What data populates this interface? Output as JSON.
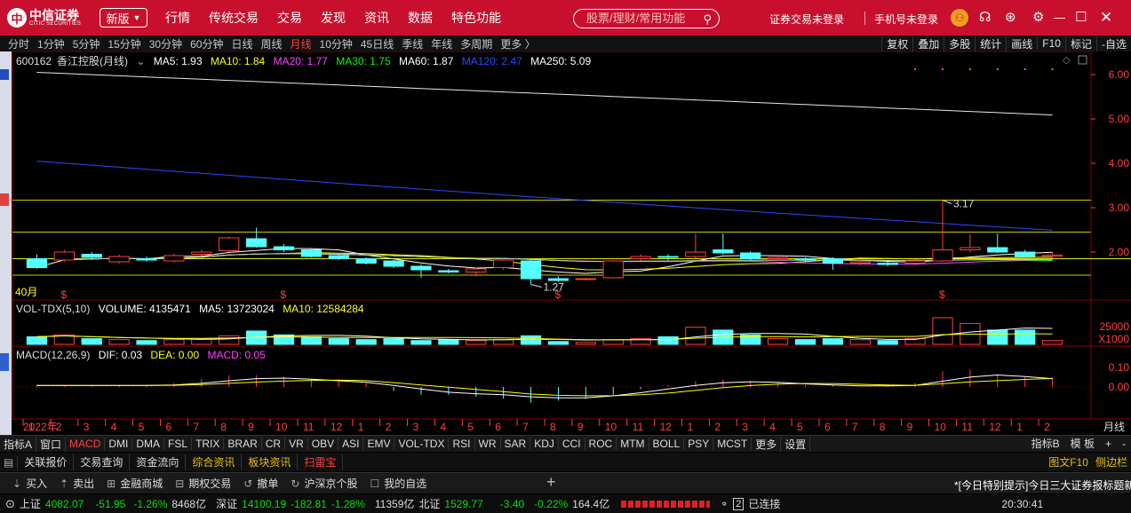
{
  "brand": {
    "logo_cn": "中信证券",
    "logo_en": "CITIC SECURITIES"
  },
  "header": {
    "edition": "新版",
    "nav": [
      "行情",
      "传统交易",
      "交易",
      "发现",
      "资讯",
      "数据",
      "特色功能"
    ],
    "search_placeholder": "股票/理财/常用功能",
    "account_status": "证券交易未登录",
    "phone_status": "手机号未登录"
  },
  "periods": [
    "分时",
    "1分钟",
    "5分钟",
    "15分钟",
    "30分钟",
    "60分钟",
    "日线",
    "周线",
    "月线",
    "10分钟",
    "45日线",
    "季线",
    "年线",
    "多周期",
    "更多 〉"
  ],
  "active_period": "月线",
  "right_tools": [
    "复权",
    "叠加",
    "多股",
    "统计",
    "画线",
    "F10",
    "标记",
    "-自选"
  ],
  "stock": {
    "code": "600162",
    "name": "香江控股(月线)"
  },
  "ma_legend": [
    {
      "label": "MA5: 1.93",
      "color": "#ffffff"
    },
    {
      "label": "MA10: 1.84",
      "color": "#ffff00"
    },
    {
      "label": "MA20: 1.77",
      "color": "#ff40ff"
    },
    {
      "label": "MA30: 1.75",
      "color": "#00ff00"
    },
    {
      "label": "MA60: 1.87",
      "color": "#ffffff"
    },
    {
      "label": "MA120: 2.47",
      "color": "#2a4cff"
    },
    {
      "label": "MA250: 5.09",
      "color": "#ffffff"
    }
  ],
  "price_axis": [
    "6.00",
    "5.00",
    "4.00",
    "3.00",
    "2.00"
  ],
  "annotations": {
    "high": "3.17",
    "low": "1.27",
    "months": "40月",
    "mark": "$"
  },
  "volume_legend": [
    {
      "label": "VOL-TDX(5,10)",
      "color": "#dddddd"
    },
    {
      "label": "VOLUME: 4135471",
      "color": "#ffffff"
    },
    {
      "label": "MA5: 13723024",
      "color": "#ffffff"
    },
    {
      "label": "MA10: 12584284",
      "color": "#ffff00"
    }
  ],
  "volume_axis": {
    "top": "25000",
    "unit": "X1000"
  },
  "macd_legend": [
    {
      "label": "MACD(12,26,9)",
      "color": "#dddddd"
    },
    {
      "label": "DIF: 0.03",
      "color": "#ffffff"
    },
    {
      "label": "DEA: 0.00",
      "color": "#ffff00"
    },
    {
      "label": "MACD: 0.05",
      "color": "#ff40ff"
    }
  ],
  "macd_axis": [
    "0.10",
    "0.00"
  ],
  "time_axis": {
    "year": "2022年",
    "months": [
      "1",
      "2",
      "3",
      "4",
      "5",
      "6",
      "7",
      "8",
      "9",
      "10",
      "11",
      "12",
      "1",
      "2",
      "3",
      "4",
      "5",
      "6",
      "7",
      "8",
      "9",
      "10",
      "11",
      "12",
      "1",
      "2",
      "3",
      "4",
      "5",
      "6",
      "7",
      "8",
      "9",
      "10",
      "11",
      "12",
      "1",
      "2"
    ],
    "period_label": "月线"
  },
  "indicator_tabs": [
    "指标A",
    "窗口",
    "MACD",
    "DMI",
    "DMA",
    "FSL",
    "TRIX",
    "BRAR",
    "CR",
    "VR",
    "OBV",
    "ASI",
    "EMV",
    "VOL-TDX",
    "RSI",
    "WR",
    "SAR",
    "KDJ",
    "CCI",
    "ROC",
    "MTM",
    "BOLL",
    "PSY",
    "MCST",
    "更多",
    "设置"
  ],
  "active_indicator": "MACD",
  "indicator_right": [
    "指标B",
    "模 板",
    "+",
    "-"
  ],
  "sub_tabs": [
    {
      "label": "关联报价",
      "color": "#dddddd"
    },
    {
      "label": "交易查询",
      "color": "#dddddd"
    },
    {
      "label": "资金流向",
      "color": "#dddddd"
    },
    {
      "label": "综合资讯",
      "color": "#e8c000"
    },
    {
      "label": "板块资讯",
      "color": "#e8c000"
    },
    {
      "label": "扫雷宝",
      "color": "#ff4040"
    }
  ],
  "sub_right": [
    "图文F10",
    "侧边栏"
  ],
  "actions": [
    {
      "icon": "⇣",
      "label": "买入"
    },
    {
      "icon": "⇡",
      "label": "卖出"
    },
    {
      "icon": "⊞",
      "label": "金融商城"
    },
    {
      "icon": "⊟",
      "label": "期权交易"
    },
    {
      "icon": "↺",
      "label": "撤单"
    },
    {
      "icon": "↻",
      "label": "沪深京个股"
    },
    {
      "icon": "☐",
      "label": "我的自选"
    }
  ],
  "notice": "*[今日特别提示]今日三大证券报标题新",
  "status": {
    "sh_label": "上证",
    "sh_price": "4082.07",
    "sh_chg": "-51.95",
    "sh_pct": "-1.26%",
    "sh_amt": "8468亿",
    "sz_label": "深证",
    "sz_price": "14100.19",
    "sz_chg": "-182.81",
    "sz_pct": "-1.28%",
    "sz_amt": "11359亿",
    "bz_label": "北证",
    "bz_price": "1529.77",
    "bz_chg": "-3.40",
    "bz_pct": "-0.22%",
    "bz_amt": "164.4亿",
    "conn": "已连接",
    "conn_count": "2",
    "time": "20:30:41"
  },
  "colors": {
    "red": "#ff4040",
    "cyan": "#54ffff",
    "title_red": "#c8102e",
    "grid_red": "#8b0000"
  },
  "chart_data": {
    "type": "candlestick",
    "ma_values": {
      "MA5": 1.93,
      "MA10": 1.84,
      "MA20": 1.77,
      "MA30": 1.75,
      "MA60": 1.87,
      "MA120": 2.47,
      "MA250": 5.09
    },
    "candles": [
      {
        "o": 1.85,
        "c": 1.65,
        "h": 1.95,
        "l": 1.62
      },
      {
        "o": 1.82,
        "c": 2.0,
        "h": 2.05,
        "l": 1.78
      },
      {
        "o": 1.95,
        "c": 1.88,
        "h": 2.0,
        "l": 1.82
      },
      {
        "o": 1.78,
        "c": 1.9,
        "h": 1.94,
        "l": 1.74
      },
      {
        "o": 1.85,
        "c": 1.82,
        "h": 1.9,
        "l": 1.78
      },
      {
        "o": 1.8,
        "c": 1.92,
        "h": 1.96,
        "l": 1.76
      },
      {
        "o": 1.95,
        "c": 2.0,
        "h": 2.05,
        "l": 1.92
      },
      {
        "o": 2.03,
        "c": 2.32,
        "h": 2.35,
        "l": 2.0
      },
      {
        "o": 2.3,
        "c": 2.12,
        "h": 2.55,
        "l": 2.1
      },
      {
        "o": 2.12,
        "c": 2.05,
        "h": 2.18,
        "l": 2.0
      },
      {
        "o": 2.05,
        "c": 1.9,
        "h": 2.08,
        "l": 1.88
      },
      {
        "o": 1.92,
        "c": 1.85,
        "h": 1.95,
        "l": 1.82
      },
      {
        "o": 1.85,
        "c": 1.75,
        "h": 1.88,
        "l": 1.72
      },
      {
        "o": 1.8,
        "c": 1.68,
        "h": 1.82,
        "l": 1.64
      },
      {
        "o": 1.68,
        "c": 1.6,
        "h": 1.72,
        "l": 1.42
      },
      {
        "o": 1.58,
        "c": 1.55,
        "h": 1.62,
        "l": 1.52
      },
      {
        "o": 1.55,
        "c": 1.62,
        "h": 1.65,
        "l": 1.45
      },
      {
        "o": 1.65,
        "c": 1.82,
        "h": 1.86,
        "l": 1.6
      },
      {
        "o": 1.8,
        "c": 1.4,
        "h": 1.84,
        "l": 1.27
      },
      {
        "o": 1.4,
        "c": 1.36,
        "h": 1.45,
        "l": 1.33
      },
      {
        "o": 1.38,
        "c": 1.4,
        "h": 1.42,
        "l": 1.36
      },
      {
        "o": 1.42,
        "c": 1.8,
        "h": 1.82,
        "l": 1.4
      },
      {
        "o": 1.85,
        "c": 1.9,
        "h": 1.95,
        "l": 1.8
      },
      {
        "o": 1.9,
        "c": 1.88,
        "h": 1.95,
        "l": 1.82
      },
      {
        "o": 1.9,
        "c": 2.0,
        "h": 2.42,
        "l": 1.86
      },
      {
        "o": 2.05,
        "c": 1.98,
        "h": 2.42,
        "l": 1.94
      },
      {
        "o": 1.98,
        "c": 1.85,
        "h": 2.02,
        "l": 1.82
      },
      {
        "o": 1.85,
        "c": 1.88,
        "h": 1.92,
        "l": 1.8
      },
      {
        "o": 1.85,
        "c": 1.82,
        "h": 1.88,
        "l": 1.78
      },
      {
        "o": 1.85,
        "c": 1.75,
        "h": 1.88,
        "l": 1.6
      },
      {
        "o": 1.75,
        "c": 1.78,
        "h": 1.82,
        "l": 1.7
      },
      {
        "o": 1.75,
        "c": 1.72,
        "h": 1.78,
        "l": 1.68
      },
      {
        "o": 1.75,
        "c": 1.8,
        "h": 1.84,
        "l": 1.7
      },
      {
        "o": 1.8,
        "c": 2.05,
        "h": 3.17,
        "l": 1.78
      },
      {
        "o": 2.05,
        "c": 2.1,
        "h": 2.4,
        "l": 2.0
      },
      {
        "o": 2.1,
        "c": 2.0,
        "h": 2.42,
        "l": 1.98
      },
      {
        "o": 2.0,
        "c": 1.9,
        "h": 2.05,
        "l": 1.88
      },
      {
        "o": 1.9,
        "c": 1.93,
        "h": 1.98,
        "l": 1.86
      }
    ],
    "volume": [
      8,
      10,
      6,
      5,
      4,
      5,
      6,
      9,
      14,
      10,
      8,
      6,
      5,
      6,
      4,
      5,
      4,
      5,
      9,
      3,
      2,
      5,
      6,
      8,
      18,
      15,
      10,
      6,
      5,
      6,
      5,
      4,
      6,
      28,
      22,
      15,
      15,
      4
    ],
    "macd": [
      0.01,
      0.01,
      0.01,
      0.01,
      0.01,
      0.02,
      0.04,
      0.06,
      0.06,
      0.05,
      0.04,
      0.03,
      0.02,
      -0.02,
      -0.04,
      -0.04,
      -0.05,
      -0.06,
      -0.08,
      -0.07,
      -0.06,
      -0.04,
      -0.01,
      0.01,
      0.03,
      0.04,
      0.03,
      0.02,
      0.01,
      0.01,
      0.0,
      0.01,
      0.02,
      0.08,
      0.09,
      0.06,
      0.05,
      0.05
    ]
  }
}
